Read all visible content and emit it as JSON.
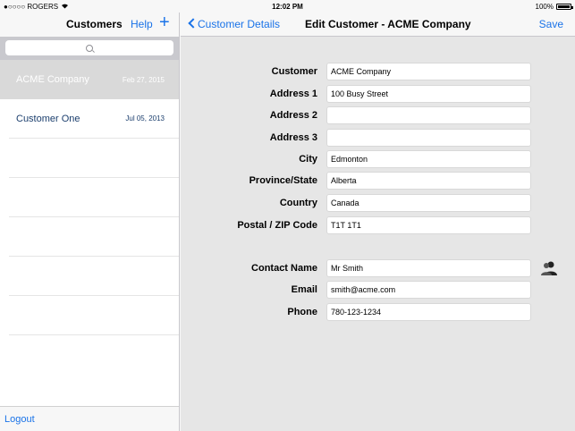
{
  "status_bar": {
    "carrier": "●○○○○ ROGERS",
    "time": "12:02 PM",
    "battery": "100%"
  },
  "master": {
    "title": "Customers",
    "help_label": "Help",
    "add_label": "+",
    "search_placeholder": "",
    "items": [
      {
        "name": "ACME Company",
        "date": "Feb 27, 2015",
        "selected": true
      },
      {
        "name": "Customer One",
        "date": "Jul 05, 2013",
        "selected": false
      }
    ],
    "logout_label": "Logout"
  },
  "detail": {
    "back_label": "Customer Details",
    "title": "Edit Customer - ACME Company",
    "save_label": "Save",
    "fields": [
      {
        "label": "Customer",
        "value": "ACME Company"
      },
      {
        "label": "Address 1",
        "value": "100 Busy Street"
      },
      {
        "label": "Address 2",
        "value": ""
      },
      {
        "label": "Address 3",
        "value": ""
      },
      {
        "label": "City",
        "value": "Edmonton"
      },
      {
        "label": "Province/State",
        "value": "Alberta"
      },
      {
        "label": "Country",
        "value": "Canada"
      },
      {
        "label": "Postal /  ZIP Code",
        "value": "T1T 1T1"
      }
    ],
    "contact_fields": [
      {
        "label": "Contact Name",
        "value": "Mr Smith"
      },
      {
        "label": "Email",
        "value": "smith@acme.com"
      },
      {
        "label": "Phone",
        "value": "780-123-1234"
      }
    ]
  },
  "colors": {
    "accent": "#1a73e8",
    "list_text": "#1c3f6e",
    "detail_bg": "#e6e6e6",
    "selected_row": "#d9d9d9"
  }
}
